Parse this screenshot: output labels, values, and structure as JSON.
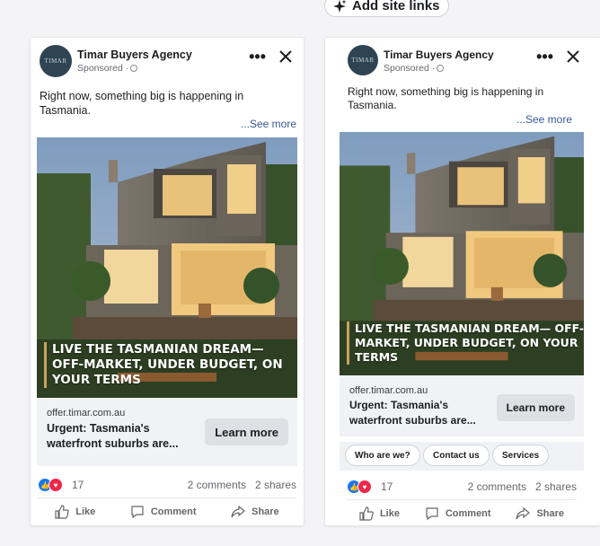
{
  "toolbar": {
    "add_site_links": "Add site links"
  },
  "avatar_text": "TIMAR",
  "colors": {
    "accent_blue": "#1877f2",
    "love_red": "#f02849",
    "link_blue": "#385898"
  },
  "ads": [
    {
      "advertiser": "Timar Buyers Agency",
      "sponsored": "Sponsored ·",
      "primary_text": "Right now, something big is happening in Tasmania.",
      "see_more": "...See more",
      "image_text": "LIVE THE TASMANIAN DREAM— OFF-MARKET, UNDER BUDGET, ON YOUR TERMS",
      "domain": "offer.timar.com.au",
      "headline": "Urgent: Tasmania's waterfront suburbs are...",
      "cta": "Learn more",
      "reactions": "17",
      "comments": "2 comments",
      "shares": "2 shares",
      "actions": {
        "like": "Like",
        "comment": "Comment",
        "share": "Share"
      }
    },
    {
      "advertiser": "Timar Buyers Agency",
      "sponsored": "Sponsored ·",
      "primary_text": "Right now, something big is happening in Tasmania.",
      "see_more": "...See more",
      "image_text": "LIVE THE TASMANIAN DREAM— OFF-MARKET, UNDER BUDGET, ON YOUR TERMS",
      "domain": "offer.timar.com.au",
      "headline": "Urgent: Tasmania's waterfront suburbs are...",
      "cta": "Learn more",
      "site_links": [
        "Who are we?",
        "Contact us",
        "Services"
      ],
      "reactions": "17",
      "comments": "2 comments",
      "shares": "2 shares",
      "actions": {
        "like": "Like",
        "comment": "Comment",
        "share": "Share"
      }
    }
  ]
}
